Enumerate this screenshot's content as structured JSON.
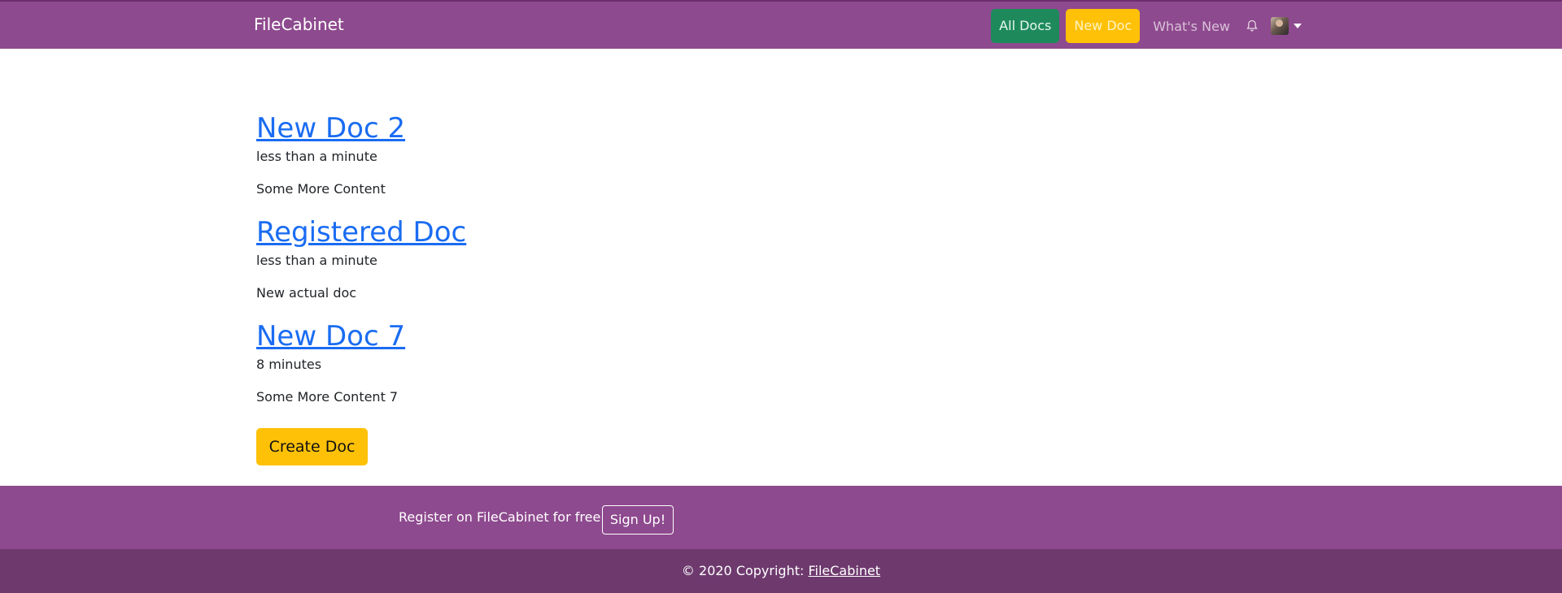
{
  "navbar": {
    "brand": "FileCabinet",
    "all_docs": "All Docs",
    "new_doc": "New Doc",
    "whats_new": "What's New",
    "icons": [
      "bell-icon",
      "avatar",
      "chevron-down-icon"
    ],
    "colors": {
      "bar": "#8e4a8e",
      "all_docs_bg": "#1e8a5c",
      "new_doc_bg": "#ffc107"
    }
  },
  "docs": [
    {
      "title": "New Doc 2",
      "time": "less than a minute",
      "body": "Some More Content"
    },
    {
      "title": "Registered Doc",
      "time": "less than a minute",
      "body": "New actual doc"
    },
    {
      "title": "New Doc 7",
      "time": "8 minutes",
      "body": "Some More Content 7"
    }
  ],
  "create_button": "Create Doc",
  "footer": {
    "register_text": "Register on FileCabinet for free",
    "signup_button": "Sign Up!",
    "copyright_prefix": "© 2020 Copyright: ",
    "copyright_link": "FileCabinet",
    "colors": {
      "top": "#8e4a8e",
      "bottom": "#6e3a6e"
    }
  }
}
